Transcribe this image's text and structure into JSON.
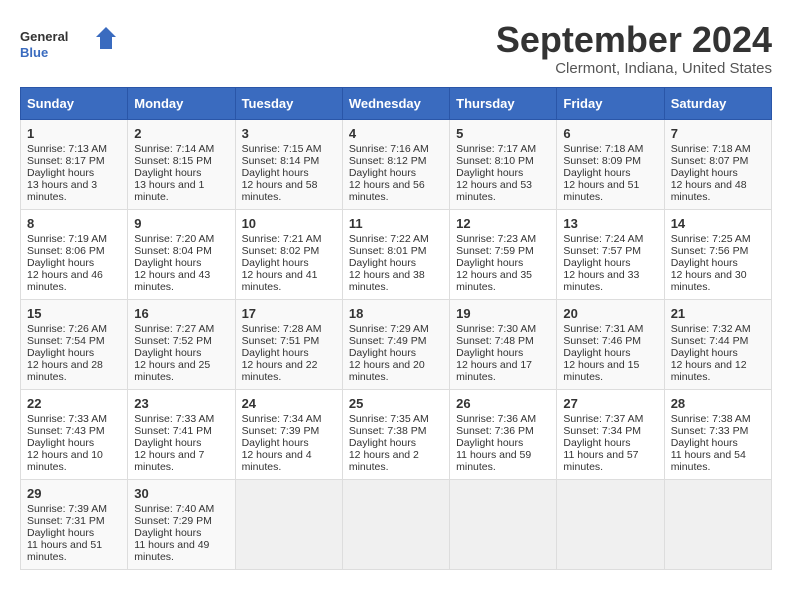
{
  "header": {
    "logo_general": "General",
    "logo_blue": "Blue",
    "month_title": "September 2024",
    "location": "Clermont, Indiana, United States"
  },
  "weekdays": [
    "Sunday",
    "Monday",
    "Tuesday",
    "Wednesday",
    "Thursday",
    "Friday",
    "Saturday"
  ],
  "weeks": [
    [
      {
        "day": "1",
        "sunrise": "7:13 AM",
        "sunset": "8:17 PM",
        "daylight": "13 hours and 3 minutes."
      },
      {
        "day": "2",
        "sunrise": "7:14 AM",
        "sunset": "8:15 PM",
        "daylight": "13 hours and 1 minute."
      },
      {
        "day": "3",
        "sunrise": "7:15 AM",
        "sunset": "8:14 PM",
        "daylight": "12 hours and 58 minutes."
      },
      {
        "day": "4",
        "sunrise": "7:16 AM",
        "sunset": "8:12 PM",
        "daylight": "12 hours and 56 minutes."
      },
      {
        "day": "5",
        "sunrise": "7:17 AM",
        "sunset": "8:10 PM",
        "daylight": "12 hours and 53 minutes."
      },
      {
        "day": "6",
        "sunrise": "7:18 AM",
        "sunset": "8:09 PM",
        "daylight": "12 hours and 51 minutes."
      },
      {
        "day": "7",
        "sunrise": "7:18 AM",
        "sunset": "8:07 PM",
        "daylight": "12 hours and 48 minutes."
      }
    ],
    [
      {
        "day": "8",
        "sunrise": "7:19 AM",
        "sunset": "8:06 PM",
        "daylight": "12 hours and 46 minutes."
      },
      {
        "day": "9",
        "sunrise": "7:20 AM",
        "sunset": "8:04 PM",
        "daylight": "12 hours and 43 minutes."
      },
      {
        "day": "10",
        "sunrise": "7:21 AM",
        "sunset": "8:02 PM",
        "daylight": "12 hours and 41 minutes."
      },
      {
        "day": "11",
        "sunrise": "7:22 AM",
        "sunset": "8:01 PM",
        "daylight": "12 hours and 38 minutes."
      },
      {
        "day": "12",
        "sunrise": "7:23 AM",
        "sunset": "7:59 PM",
        "daylight": "12 hours and 35 minutes."
      },
      {
        "day": "13",
        "sunrise": "7:24 AM",
        "sunset": "7:57 PM",
        "daylight": "12 hours and 33 minutes."
      },
      {
        "day": "14",
        "sunrise": "7:25 AM",
        "sunset": "7:56 PM",
        "daylight": "12 hours and 30 minutes."
      }
    ],
    [
      {
        "day": "15",
        "sunrise": "7:26 AM",
        "sunset": "7:54 PM",
        "daylight": "12 hours and 28 minutes."
      },
      {
        "day": "16",
        "sunrise": "7:27 AM",
        "sunset": "7:52 PM",
        "daylight": "12 hours and 25 minutes."
      },
      {
        "day": "17",
        "sunrise": "7:28 AM",
        "sunset": "7:51 PM",
        "daylight": "12 hours and 22 minutes."
      },
      {
        "day": "18",
        "sunrise": "7:29 AM",
        "sunset": "7:49 PM",
        "daylight": "12 hours and 20 minutes."
      },
      {
        "day": "19",
        "sunrise": "7:30 AM",
        "sunset": "7:48 PM",
        "daylight": "12 hours and 17 minutes."
      },
      {
        "day": "20",
        "sunrise": "7:31 AM",
        "sunset": "7:46 PM",
        "daylight": "12 hours and 15 minutes."
      },
      {
        "day": "21",
        "sunrise": "7:32 AM",
        "sunset": "7:44 PM",
        "daylight": "12 hours and 12 minutes."
      }
    ],
    [
      {
        "day": "22",
        "sunrise": "7:33 AM",
        "sunset": "7:43 PM",
        "daylight": "12 hours and 10 minutes."
      },
      {
        "day": "23",
        "sunrise": "7:33 AM",
        "sunset": "7:41 PM",
        "daylight": "12 hours and 7 minutes."
      },
      {
        "day": "24",
        "sunrise": "7:34 AM",
        "sunset": "7:39 PM",
        "daylight": "12 hours and 4 minutes."
      },
      {
        "day": "25",
        "sunrise": "7:35 AM",
        "sunset": "7:38 PM",
        "daylight": "12 hours and 2 minutes."
      },
      {
        "day": "26",
        "sunrise": "7:36 AM",
        "sunset": "7:36 PM",
        "daylight": "11 hours and 59 minutes."
      },
      {
        "day": "27",
        "sunrise": "7:37 AM",
        "sunset": "7:34 PM",
        "daylight": "11 hours and 57 minutes."
      },
      {
        "day": "28",
        "sunrise": "7:38 AM",
        "sunset": "7:33 PM",
        "daylight": "11 hours and 54 minutes."
      }
    ],
    [
      {
        "day": "29",
        "sunrise": "7:39 AM",
        "sunset": "7:31 PM",
        "daylight": "11 hours and 51 minutes."
      },
      {
        "day": "30",
        "sunrise": "7:40 AM",
        "sunset": "7:29 PM",
        "daylight": "11 hours and 49 minutes."
      },
      null,
      null,
      null,
      null,
      null
    ]
  ],
  "labels": {
    "sunrise": "Sunrise:",
    "sunset": "Sunset:",
    "daylight": "Daylight hours"
  }
}
